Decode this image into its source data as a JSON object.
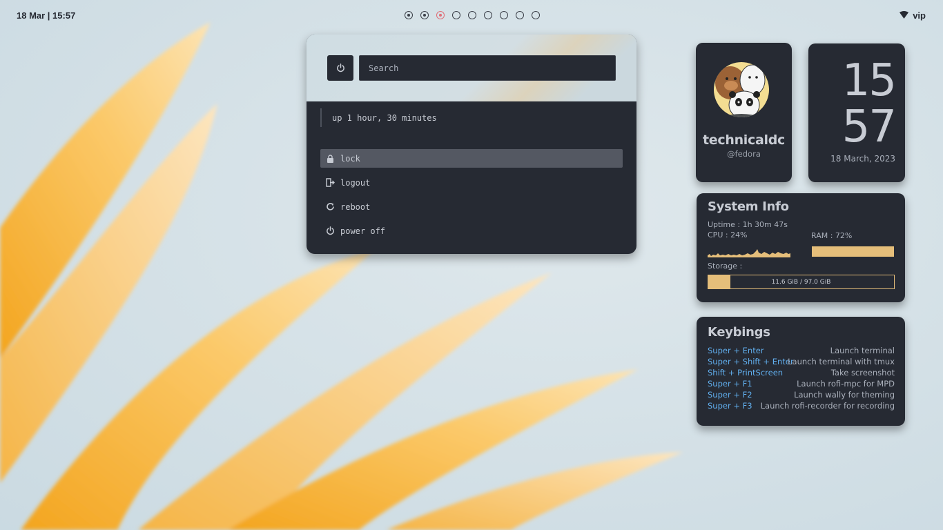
{
  "topbar": {
    "clock": "18 Mar | 15:57",
    "workspaces": [
      {
        "state": "occupied"
      },
      {
        "state": "occupied"
      },
      {
        "state": "active"
      },
      {
        "state": "empty"
      },
      {
        "state": "empty"
      },
      {
        "state": "empty"
      },
      {
        "state": "empty"
      },
      {
        "state": "empty"
      },
      {
        "state": "empty"
      }
    ],
    "network": {
      "icon": "wifi-icon",
      "label": "vip"
    }
  },
  "power_menu": {
    "search_placeholder": "Search",
    "uptime": "up 1 hour, 30 minutes",
    "items": [
      {
        "label": "lock",
        "icon": "lock-icon",
        "selected": true
      },
      {
        "label": "logout",
        "icon": "logout-icon",
        "selected": false
      },
      {
        "label": "reboot",
        "icon": "reboot-icon",
        "selected": false
      },
      {
        "label": "power off",
        "icon": "power-icon",
        "selected": false
      }
    ]
  },
  "profile": {
    "username": "technicaldc",
    "handle": "@fedora"
  },
  "clock": {
    "hours": "15",
    "minutes": "57",
    "date": "18 March, 2023"
  },
  "system_info": {
    "title": "System Info",
    "uptime": "Uptime : 1h 30m 47s",
    "cpu_label": "CPU : 24%",
    "ram_label": "RAM : 72%",
    "ram_percent": 72,
    "storage_label": "Storage :",
    "storage_text": "11.6 GiB / 97.0 GiB",
    "storage_used": 11.6,
    "storage_total": 97.0
  },
  "keybinds": {
    "title": "Keybings",
    "rows": [
      {
        "key": "Super + Enter",
        "action": "Launch terminal"
      },
      {
        "key": "Super + Shift + Enter",
        "action": "Launch terminal with tmux"
      },
      {
        "key": "Shift + PrintScreen",
        "action": "Take screenshot"
      },
      {
        "key": "Super + F1",
        "action": "Launch rofi-mpc for MPD"
      },
      {
        "key": "Super + F2",
        "action": "Launch wally for theming"
      },
      {
        "key": "Super + F3",
        "action": "Launch rofi-recorder for recording"
      }
    ]
  },
  "colors": {
    "panel": "#262a33",
    "accent": "#e5be7a",
    "keybind": "#61afef",
    "active_workspace": "#e06c75"
  }
}
